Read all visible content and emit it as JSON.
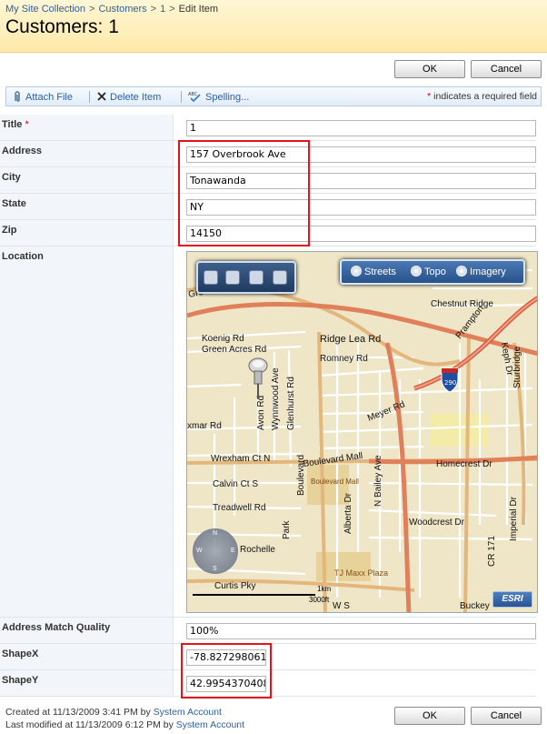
{
  "breadcrumb": [
    "My Site Collection",
    "Customers",
    "1",
    "Edit Item"
  ],
  "page_title": "Customers: 1",
  "buttons": {
    "ok": "OK",
    "cancel": "Cancel"
  },
  "toolbar": {
    "attach_file": "Attach File",
    "delete_item": "Delete Item",
    "spelling": "Spelling...",
    "required_note": "indicates a required field",
    "required_star": "*"
  },
  "fields": {
    "title": {
      "label": "Title",
      "value": "1"
    },
    "address": {
      "label": "Address",
      "value": "157 Overbrook Ave"
    },
    "city": {
      "label": "City",
      "value": "Tonawanda"
    },
    "state": {
      "label": "State",
      "value": "NY"
    },
    "zip": {
      "label": "Zip",
      "value": "14150"
    },
    "location": {
      "label": "Location"
    },
    "match_quality": {
      "label": "Address Match Quality",
      "value": "100%"
    },
    "shapex": {
      "label": "ShapeX",
      "value": "-78.8272980614"
    },
    "shapey": {
      "label": "ShapeY",
      "value": "42.9954370408"
    }
  },
  "map": {
    "basemaps": [
      "Streets",
      "Topo",
      "Imagery"
    ],
    "esri": "ESRI",
    "highway_shield": "290",
    "scale": {
      "top": "1km",
      "bottom": "3000ft"
    },
    "nav_letters": {
      "n": "N",
      "s": "S",
      "w": "W",
      "e": "E"
    },
    "labels": {
      "greentree": "Greentre",
      "chestnut": "Chestnut Ridge",
      "koenig": "Koenig Rd",
      "green_acres": "Green Acres Rd",
      "ridge_lea": "Ridge Lea Rd",
      "keph": "Keph Dr",
      "romney": "Romney Rd",
      "avon": "Avon Rd",
      "wynnwood": "Wynnwood Ave",
      "glenhurst": "Glenhurst Rd",
      "sturbridge": "Sturbridge",
      "xmar": "xmar Rd",
      "meyer": "Meyer Rd",
      "wrexham": "Wrexham Ct N",
      "boulevard_mall": "Boulevard Mall",
      "boulevard_mall_poi": "Boulevard Mall",
      "n_bailey": "N Bailey Ave",
      "homecrest": "Homecrest Dr",
      "calvin": "Calvin Ct S",
      "treadwell": "Treadwell Rd",
      "alberta": "Alberta Dr",
      "woodcrest": "Woodcrest Dr",
      "rochelle": "Rochelle",
      "park": "Park",
      "tj_maxx": "TJ Maxx Plaza",
      "curtis": "Curtis Pky",
      "cr171": "CR 171",
      "imperial": "Imperial Dr",
      "buckey": "Buckey",
      "blvd": "Boulevard",
      "prampton": "Prampton",
      "ws": "W S"
    }
  },
  "footer": {
    "created_prefix": "Created at 11/13/2009 3:41 PM  by",
    "modified_prefix": "Last modified at 11/13/2009 6:12 PM  by",
    "author": "System Account"
  }
}
